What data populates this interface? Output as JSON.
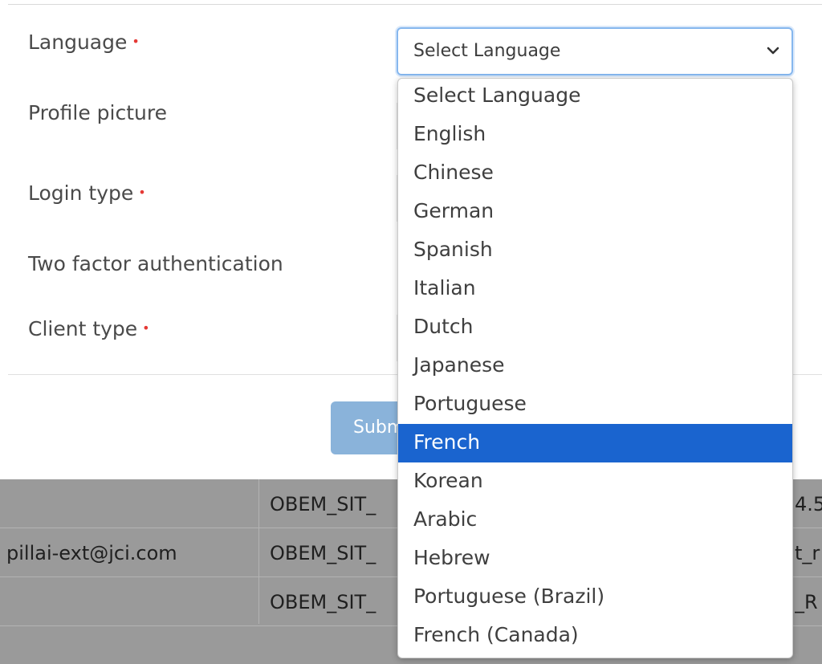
{
  "form": {
    "fields": [
      {
        "label": "Language",
        "required": true
      },
      {
        "label": "Profile picture",
        "required": false
      },
      {
        "label": "Login type",
        "required": true
      },
      {
        "label": "Two factor authentication",
        "required": false
      },
      {
        "label": "Client type",
        "required": true
      }
    ],
    "required_marker": "•",
    "submit_label": "Submit",
    "language_select": {
      "value": "Select Language",
      "options": [
        "Select Language",
        "English",
        "Chinese",
        "German",
        "Spanish",
        "Italian",
        "Dutch",
        "Japanese",
        "Portuguese",
        "French",
        "Korean",
        "Arabic",
        "Hebrew",
        "Portuguese (Brazil)",
        "French (Canada)"
      ],
      "highlighted": "French"
    }
  },
  "background_table": {
    "rows": [
      {
        "email": "",
        "name": "OBEM_SIT_",
        "tail": "4.5"
      },
      {
        "email": "pillai-ext@jci.com",
        "name": "OBEM_SIT_",
        "tail": "t_r"
      },
      {
        "email": "",
        "name": "OBEM_SIT_",
        "tail": "_R"
      }
    ]
  },
  "colors": {
    "accent": "#1a64cf",
    "required": "#e53935",
    "focus_border": "#86b7ee",
    "submit": "#8ab3da"
  }
}
